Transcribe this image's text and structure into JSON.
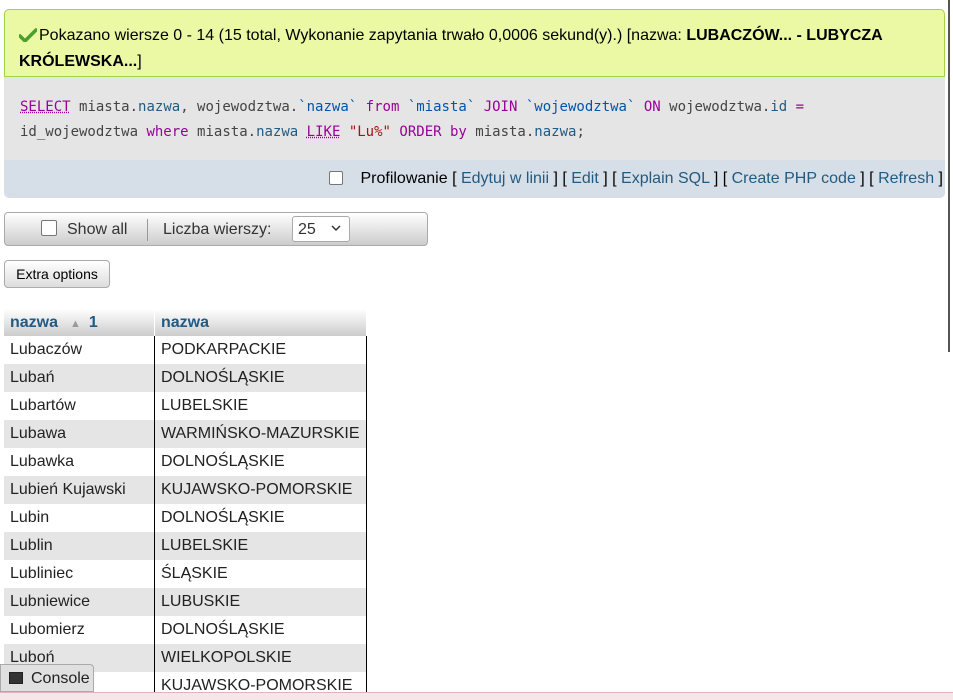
{
  "success": {
    "text_prefix": "Pokazano wiersze 0 - 14 (15 total, Wykonanie zapytania trwało 0,0006 sekund(y).) [nazwa: ",
    "bold_range": "LUBACZÓW... - LUBYCZA KRÓLEWSKA...",
    "text_suffix": "]"
  },
  "sql": {
    "kw_select": "SELECT",
    "t1": "miasta.",
    "f1": "nazwa",
    "t2": ", wojewodztwa.",
    "f2": "`nazwa`",
    "kw_from": "from",
    "f3": "`miasta`",
    "kw_join": "JOIN",
    "f4": "`wojewodztwa`",
    "kw_on": "ON",
    "t3": "wojewodztwa.",
    "f5": "id",
    "op_eq": "=",
    "t4": "id_wojewodztwa",
    "kw_where": "where",
    "t5": "miasta.",
    "f6": "nazwa",
    "kw_like": "LIKE",
    "s1": "\"Lu%\"",
    "kw_order": "ORDER by",
    "t6": "miasta.",
    "f7": "nazwa",
    "t7": ";"
  },
  "toolbar": {
    "profiling": "Profilowanie",
    "inline_edit": "Edytuj w linii",
    "edit": "Edit",
    "explain": "Explain SQL",
    "php": "Create PHP code",
    "refresh": "Refresh"
  },
  "navigation": {
    "show_all": "Show all",
    "rows_label": "Liczba wierszy:",
    "rows_value": "25"
  },
  "extra_options": "Extra options",
  "table": {
    "headers": [
      "nazwa",
      "nazwa"
    ],
    "sort_index": "1",
    "rows": [
      [
        "Lubaczów",
        "PODKARPACKIE"
      ],
      [
        "Lubań",
        "DOLNOŚLĄSKIE"
      ],
      [
        "Lubartów",
        "LUBELSKIE"
      ],
      [
        "Lubawa",
        "WARMIŃSKO-MAZURSKIE"
      ],
      [
        "Lubawka",
        "DOLNOŚLĄSKIE"
      ],
      [
        "Lubień Kujawski",
        "KUJAWSKO-POMORSKIE"
      ],
      [
        "Lubin",
        "DOLNOŚLĄSKIE"
      ],
      [
        "Lublin",
        "LUBELSKIE"
      ],
      [
        "Lubliniec",
        "ŚLĄSKIE"
      ],
      [
        "Lubniewice",
        "LUBUSKIE"
      ],
      [
        "Lubomierz",
        "DOLNOŚLĄSKIE"
      ],
      [
        "Luboń",
        "WIELKOPOLSKIE"
      ],
      [
        "",
        "KUJAWSKO-POMORSKIE"
      ]
    ]
  },
  "console": {
    "label": "Console"
  }
}
